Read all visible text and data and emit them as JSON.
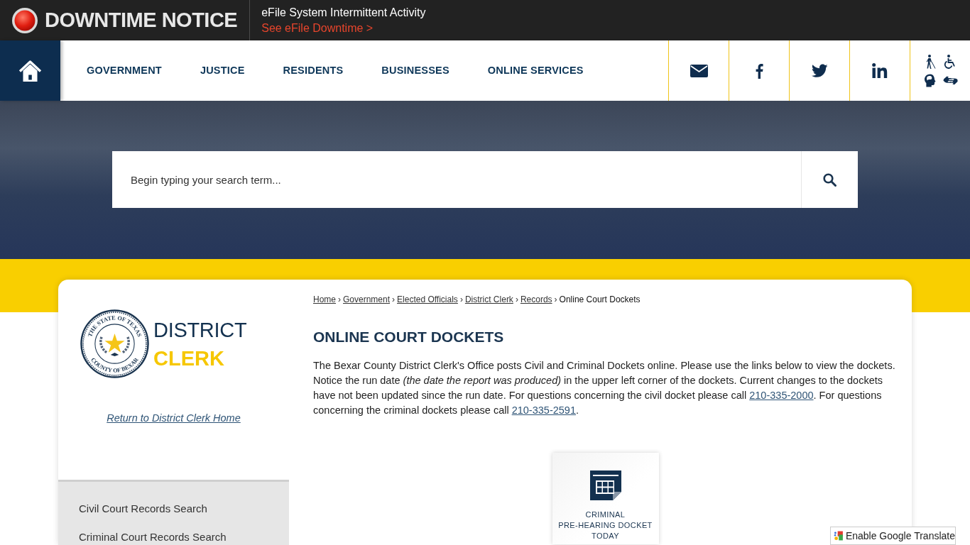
{
  "alert_bar": {
    "title": "DOWNTIME NOTICE",
    "message": "eFile System Intermittent Activity",
    "link": "See eFile Downtime >"
  },
  "nav": {
    "items": [
      "GOVERNMENT",
      "JUSTICE",
      "RESIDENTS",
      "BUSINESSES",
      "ONLINE SERVICES"
    ]
  },
  "search": {
    "placeholder": "Begin typing your search term..."
  },
  "sidebar": {
    "seal": {
      "top_text": "THE STATE OF TEXAS",
      "bottom_text": "COUNTY OF BEXAR"
    },
    "logo": {
      "line_1": "DISTRICT",
      "line_2": "CLERK"
    },
    "return_link": "Return to District Clerk Home",
    "menu": [
      "Civil Court Records Search",
      "Criminal Court Records Search"
    ]
  },
  "breadcrumb": {
    "separator": "›",
    "links": [
      "Home",
      "Government",
      "Elected Officials",
      "District Clerk",
      "Records"
    ],
    "current": "Online Court Dockets"
  },
  "page_title": "ONLINE COURT DOCKETS",
  "intro": [
    {
      "kind": "text",
      "text": "The Bexar County District Clerk's Office posts Civil and Criminal Dockets online. Please use the links below to view the dockets. Notice the run date *(the date the report was produced)* in the upper left corner of the dockets. Current changes to the dockets have not been updated since the run date. For questions concerning the civil docket please call "
    },
    {
      "kind": "link",
      "text": "210-335-2000"
    },
    {
      "kind": "text",
      "text": ". For questions concerning the criminal dockets please call "
    },
    {
      "kind": "link",
      "text": "210-335-2591"
    },
    {
      "kind": "text",
      "text": "."
    }
  ],
  "docket_tiles": [
    {
      "label_lines": [
        "CRIMINAL",
        "PRE-HEARING DOCKET",
        "TODAY"
      ]
    }
  ],
  "translate_widget": {
    "label": "Enable Google Translate"
  }
}
